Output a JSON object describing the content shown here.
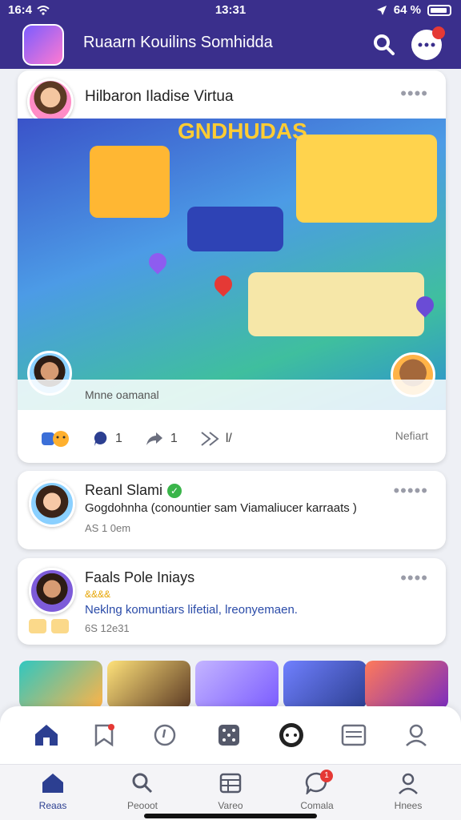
{
  "status_bar": {
    "left": "16:4",
    "time": "13:31",
    "battery": "64 %"
  },
  "header": {
    "title": "Ruaarn Kouilins Somhidda",
    "chat_badge": ""
  },
  "feed": {
    "post1": {
      "author": "Hilbaron Iladise Virtua",
      "more": "••••",
      "scene": {
        "banner": "GNDHUDAS",
        "caption": "Mnne oamanal"
      },
      "reactions": {
        "comments": "1",
        "shares": "1",
        "sends": "l/"
      },
      "more_link": "Nefiart"
    },
    "post2": {
      "author": "Reanl Slami",
      "text": "Gogdohnha (conountier sam Viamaliucer karraats )",
      "time": "AS 1 0em",
      "more": "•••••"
    },
    "post3": {
      "author": "Faals Pole Iniays",
      "stars": "&&&&",
      "text": "Neklng komuntiars lifetial, lreonyemaen.",
      "time": "6S 12e31",
      "more": "••••"
    }
  },
  "bottom_nav": [
    {
      "label": "Reaas",
      "icon": "home-icon"
    },
    {
      "label": "Peooot",
      "icon": "search-icon"
    },
    {
      "label": "Vareo",
      "icon": "grid-icon"
    },
    {
      "label": "Comala",
      "icon": "chat-icon",
      "badge": "1"
    },
    {
      "label": "Hnees",
      "icon": "profile-icon"
    }
  ],
  "colors": {
    "brand": "#3a2f8c",
    "nav_active": "#2c3f91",
    "badge": "#e53935",
    "verified": "#3ab54a"
  }
}
